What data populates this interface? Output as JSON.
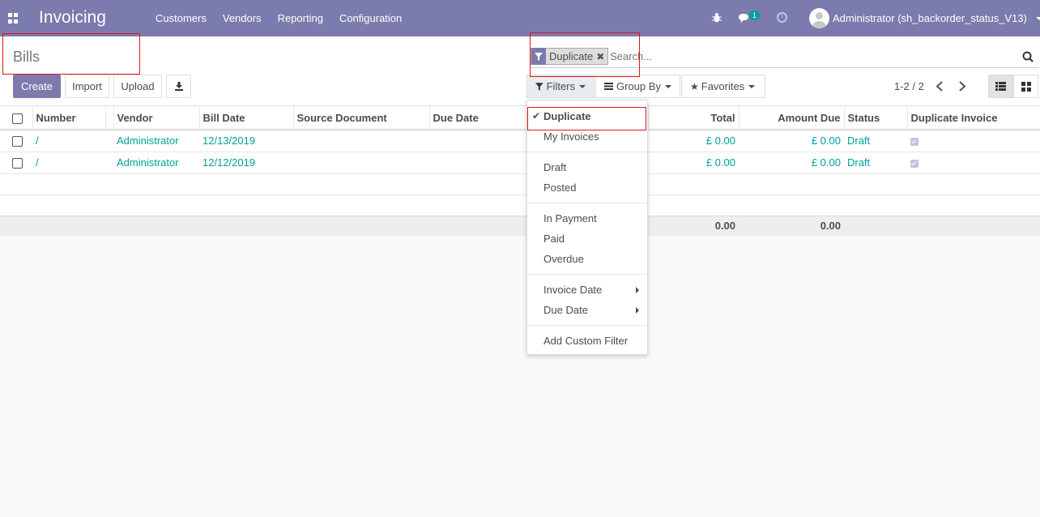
{
  "navbar": {
    "brand": "Invoicing",
    "menu": [
      "Customers",
      "Vendors",
      "Reporting",
      "Configuration"
    ],
    "chat_badge": "1",
    "user": "Administrator (sh_backorder_status_V13)",
    "color": "#7c7bad"
  },
  "control_panel": {
    "title": "Bills",
    "buttons": {
      "create": "Create",
      "import": "Import",
      "upload": "Upload"
    },
    "search": {
      "facet": "Duplicate",
      "placeholder": "Search..."
    },
    "filters_label": "Filters",
    "groupby_label": "Group By",
    "favorites_label": "Favorites",
    "pager": "1-2 / 2"
  },
  "table": {
    "columns": {
      "number": "Number",
      "vendor": "Vendor",
      "bill_date": "Bill Date",
      "source": "Source Document",
      "due_date": "Due Date",
      "total": "Total",
      "amount_due": "Amount Due",
      "status": "Status",
      "duplicate": "Duplicate Invoice"
    },
    "rows": [
      {
        "number": "/",
        "vendor": "Administrator",
        "bill_date": "12/13/2019",
        "total": "£ 0.00",
        "amount_due": "£ 0.00",
        "status": "Draft"
      },
      {
        "number": "/",
        "vendor": "Administrator",
        "bill_date": "12/12/2019",
        "total": "£ 0.00",
        "amount_due": "£ 0.00",
        "status": "Draft"
      }
    ],
    "footer": {
      "total": "0.00",
      "amount_due": "0.00"
    }
  },
  "filters_menu": {
    "group1": [
      "Duplicate",
      "My Invoices"
    ],
    "group2": [
      "Draft",
      "Posted"
    ],
    "group3": [
      "In Payment",
      "Paid",
      "Overdue"
    ],
    "group4": [
      "Invoice Date",
      "Due Date"
    ],
    "custom": "Add Custom Filter"
  },
  "colors": {
    "accent": "#7c7bad",
    "link": "#00a09d",
    "highlight": "#e0151a"
  }
}
